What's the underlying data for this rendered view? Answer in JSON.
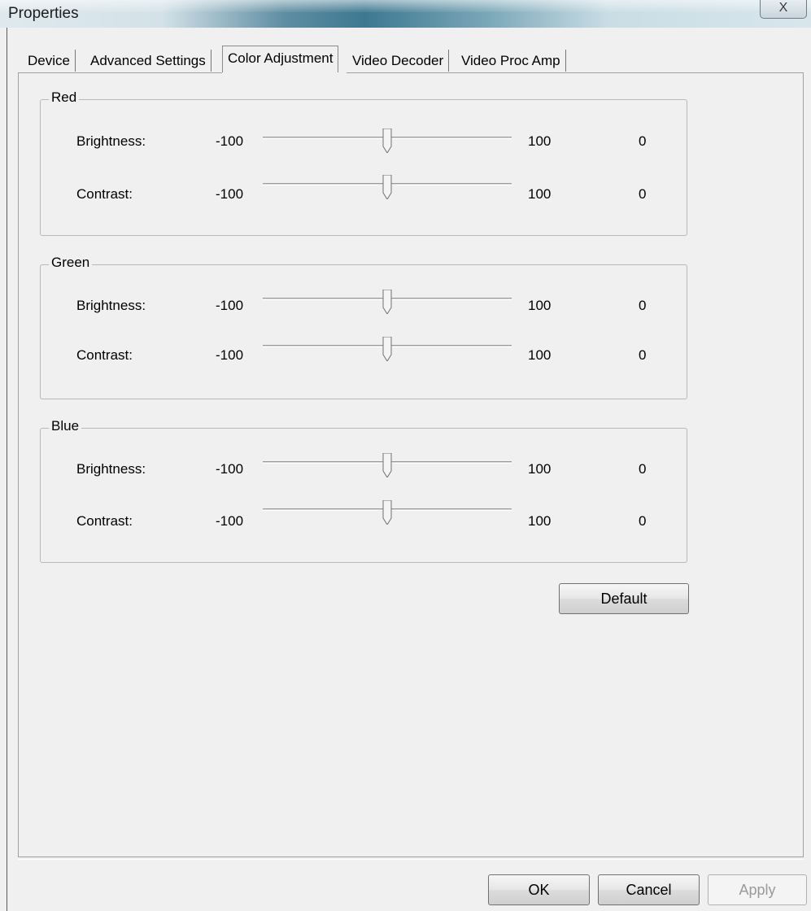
{
  "window": {
    "title": "Properties",
    "close_label": "X"
  },
  "tabs": [
    {
      "label": "Device",
      "active": false
    },
    {
      "label": "Advanced Settings",
      "active": false
    },
    {
      "label": "Color Adjustment",
      "active": true
    },
    {
      "label": "Video Decoder",
      "active": false
    },
    {
      "label": "Video Proc Amp",
      "active": false
    }
  ],
  "groups": [
    {
      "title": "Red",
      "rows": [
        {
          "label": "Brightness:",
          "min": "-100",
          "max": "100",
          "value": "0",
          "slider_fraction": 0.5
        },
        {
          "label": "Contrast:",
          "min": "-100",
          "max": "100",
          "value": "0",
          "slider_fraction": 0.5
        }
      ]
    },
    {
      "title": "Green",
      "rows": [
        {
          "label": "Brightness:",
          "min": "-100",
          "max": "100",
          "value": "0",
          "slider_fraction": 0.5
        },
        {
          "label": "Contrast:",
          "min": "-100",
          "max": "100",
          "value": "0",
          "slider_fraction": 0.5
        }
      ]
    },
    {
      "title": "Blue",
      "rows": [
        {
          "label": "Brightness:",
          "min": "-100",
          "max": "100",
          "value": "0",
          "slider_fraction": 0.5
        },
        {
          "label": "Contrast:",
          "min": "-100",
          "max": "100",
          "value": "0",
          "slider_fraction": 0.5
        }
      ]
    }
  ],
  "buttons": {
    "default_label": "Default",
    "ok_label": "OK",
    "cancel_label": "Cancel",
    "apply_label": "Apply"
  }
}
